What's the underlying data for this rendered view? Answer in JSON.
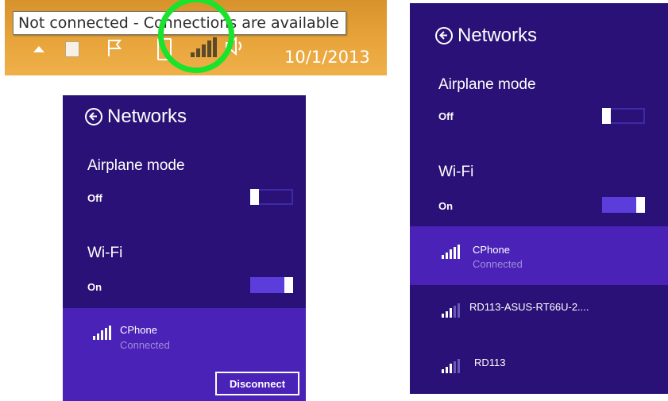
{
  "taskbar": {
    "tooltip": "Not connected - Connections are available",
    "date": "10/1/2013",
    "highlight_color": "#19e32c"
  },
  "colors": {
    "panel_bg": "#2a1177",
    "selected_row_bg": "#4a22b7",
    "toggle_on": "#5b3ddc"
  },
  "panel_a": {
    "title": "Networks",
    "airplane": {
      "label": "Airplane mode",
      "state": "Off"
    },
    "wifi": {
      "label": "Wi-Fi",
      "state": "On"
    },
    "networks": [
      {
        "name": "CPhone",
        "status": "Connected",
        "selected": true
      }
    ],
    "disconnect_label": "Disconnect"
  },
  "panel_b": {
    "title": "Networks",
    "airplane": {
      "label": "Airplane mode",
      "state": "Off"
    },
    "wifi": {
      "label": "Wi-Fi",
      "state": "On"
    },
    "networks": [
      {
        "name": "CPhone",
        "status": "Connected",
        "selected": true
      },
      {
        "name": "RD113-ASUS-RT66U-2....",
        "status": "",
        "selected": false
      },
      {
        "name": "RD113",
        "status": "",
        "selected": false
      }
    ]
  }
}
